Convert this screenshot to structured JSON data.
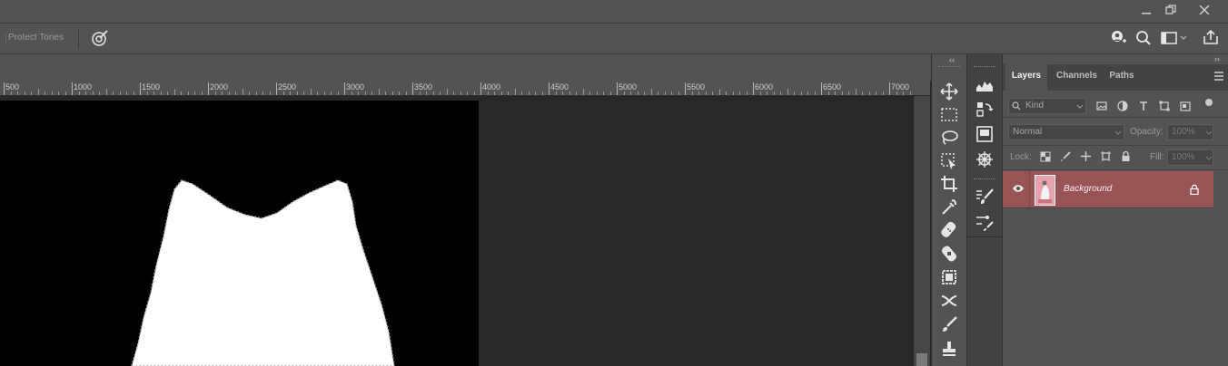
{
  "options_bar": {
    "protect_tones_label": "Protect Tones"
  },
  "ruler": {
    "labels": [
      "500",
      "1000",
      "1500",
      "2000",
      "2500",
      "3000",
      "3500",
      "4000",
      "4500",
      "5000",
      "5500",
      "6000",
      "6500",
      "7000"
    ]
  },
  "layers_panel": {
    "tabs": [
      "Layers",
      "Channels",
      "Paths"
    ],
    "active_tab": "Layers",
    "filter_placeholder": "Kind",
    "blend_mode": "Normal",
    "opacity_label": "Opacity:",
    "opacity_value": "100%",
    "lock_label": "Lock:",
    "fill_label": "Fill:",
    "fill_value": "100%",
    "layers": [
      {
        "name": "Background",
        "visible": true,
        "locked": true,
        "selected": true
      }
    ]
  },
  "colors": {
    "accent_selected_layer": "#985454",
    "panel_bg": "#535353",
    "canvas_bg": "#282828"
  }
}
